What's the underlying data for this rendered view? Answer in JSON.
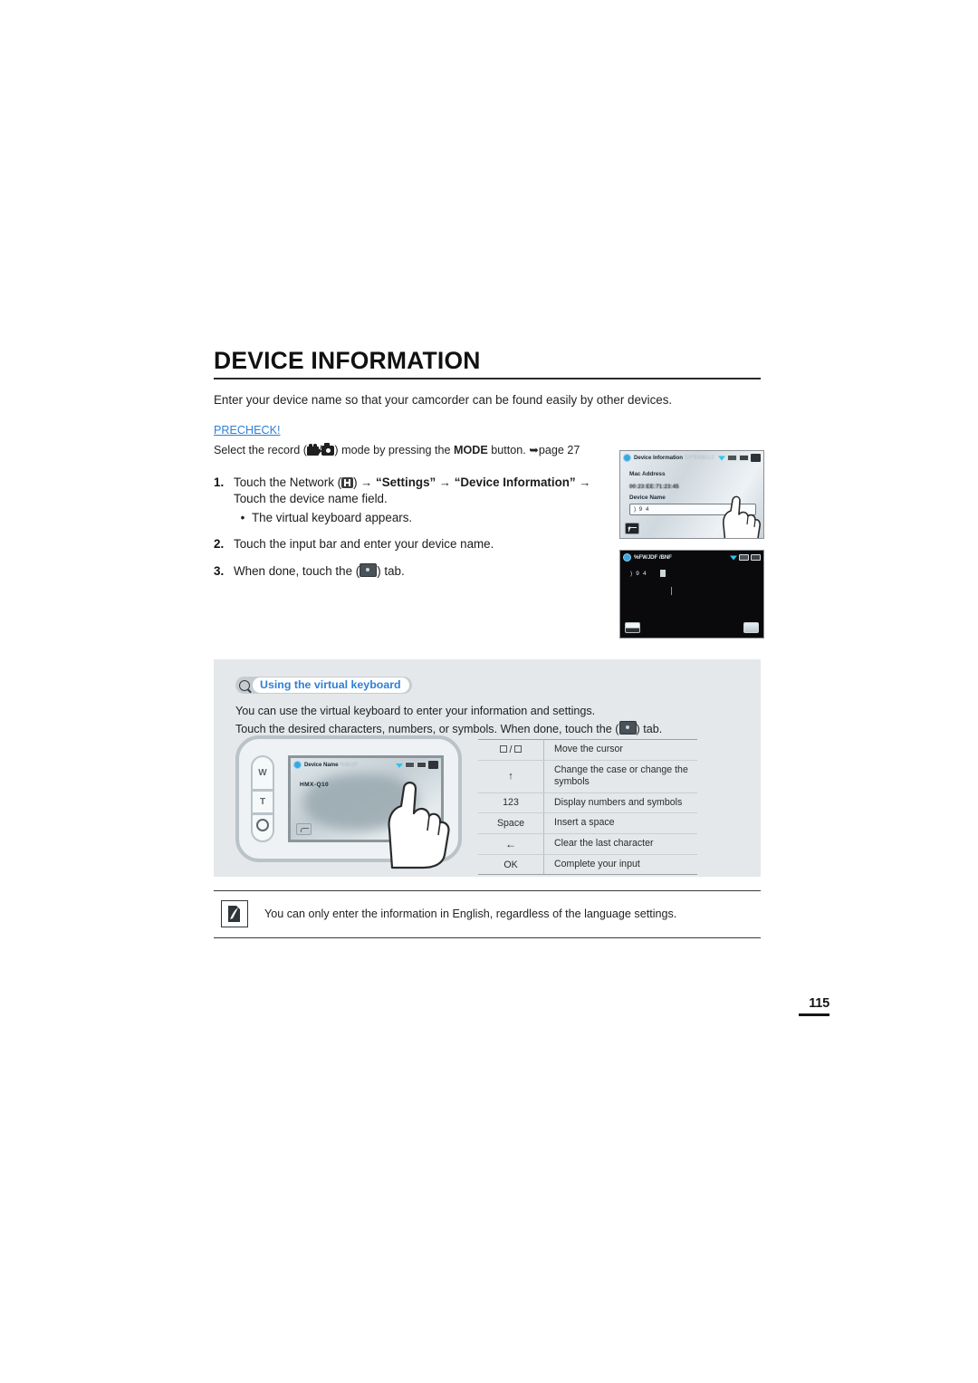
{
  "document": {
    "page_number": "115"
  },
  "section": {
    "title": "DEVICE INFORMATION",
    "intro": "Enter your device name so that your camcorder can be found easily by other devices."
  },
  "precheck": {
    "label": "PRECHECK!",
    "text_before": "Select the record (",
    "separator": "/",
    "text_middle": ") mode by pressing the ",
    "mode_bold": "MODE",
    "text_after": " button. ",
    "arrow": "➥",
    "page_ref": "page 27",
    "icon_camcorder": "camcorder-icon",
    "icon_camera": "camera-icon"
  },
  "steps": [
    {
      "number": "1.",
      "text_a": "Touch the Network (",
      "network_icon": "network-icon",
      "text_b": ") ",
      "arrow1": "→",
      "quote_settings": "“Settings”",
      "arrow2": "→",
      "quote_device_info": "“Device Information”",
      "arrow3": "→",
      "line2": "Touch the device name field.",
      "bullet": "The virtual keyboard appears."
    },
    {
      "number": "2.",
      "text": "Touch the input bar and enter your device name."
    },
    {
      "number": "3.",
      "text_a": "When done, touch the (",
      "ok_icon": "ok-tab-icon",
      "text_b": ") tab."
    }
  ],
  "screenshots": {
    "device_info": {
      "title": "Device Information",
      "ghost_text": "SPSNBUJ",
      "mac_label": "Mac Address",
      "mac_value": "00:23:EE:71:23:45",
      "name_label": "Device Name",
      "input_value": ")  9  4",
      "back_button": "back-icon",
      "status_icons": [
        "wifi-icon",
        "card-icon",
        "battery-icon",
        "mode-icon"
      ]
    },
    "keyboard": {
      "title": "%FWJDF /BNF",
      "entry_text": ")  9  4",
      "left_button": "shift-key-icon",
      "right_button": "ok-key-icon",
      "status_icons": [
        "wifi-icon",
        "card-icon",
        "battery-icon"
      ]
    }
  },
  "tip": {
    "badge_icon": "magnifier-icon",
    "badge_label": "Using the virtual keyboard",
    "line1": "You can use the virtual keyboard to enter your information and settings.",
    "line2_a": "Touch the desired characters, numbers, or symbols. When done, touch the (",
    "line2_icon": "ok-tab-icon",
    "line2_b": ") tab.",
    "illustration": {
      "zoom_w": "W",
      "zoom_t": "T",
      "lcd_title": "Device Name",
      "lcd_ghost": "%BUF",
      "lcd_value": "HMX-Q10",
      "back_button": "back-icon",
      "ok_button": "ok-tab-icon",
      "hand": "pointing-hand-icon"
    },
    "key_table": [
      {
        "key_type": "arrows",
        "key": "□ / □",
        "desc": "Move the cursor"
      },
      {
        "key_type": "up",
        "key": "↑",
        "desc": "Change the case or change the symbols"
      },
      {
        "key_type": "text",
        "key": "123",
        "desc": "Display numbers and symbols"
      },
      {
        "key_type": "text",
        "key": "Space",
        "desc": "Insert a space"
      },
      {
        "key_type": "back",
        "key": "←",
        "desc": "Clear the last character"
      },
      {
        "key_type": "text",
        "key": "OK",
        "desc": "Complete your input"
      }
    ]
  },
  "note": {
    "icon": "note-pen-icon",
    "text": "You can only enter the information in English, regardless of the language settings."
  },
  "colors": {
    "accent_blue": "#2f7fd6",
    "tip_background": "#e4e8ea",
    "text": "#222222"
  }
}
